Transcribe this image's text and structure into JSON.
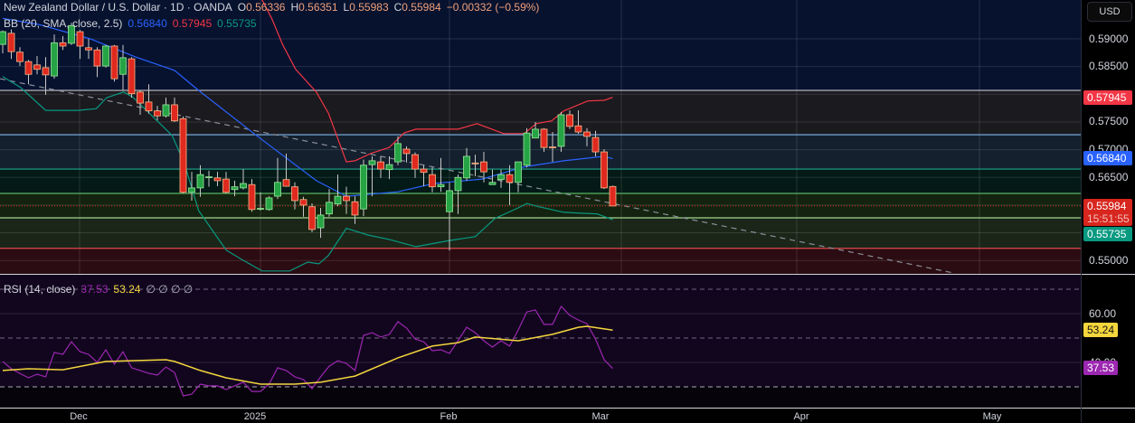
{
  "header": {
    "symbol_title": "New Zealand Dollar / U.S. Dollar · 1D · OANDA",
    "open_label": "O",
    "open": "0.56336",
    "high_label": "H",
    "high": "0.56351",
    "low_label": "L",
    "low": "0.55983",
    "close_label": "C",
    "close": "0.55984",
    "change": "−0.00332 (−0.59%)"
  },
  "bb_legend": {
    "label": "BB (20, SMA, close, 2.5)",
    "basis": "0.56840",
    "upper": "0.57945",
    "lower": "0.55735"
  },
  "rsi_legend": {
    "label": "RSI (14, close)",
    "rsi": "37.53",
    "ma": "53.24",
    "extras": "∅ ∅ ∅ ∅"
  },
  "price_axis": {
    "currency": "USD",
    "ticks": [
      "0.59000",
      "0.58500",
      "0.57500",
      "0.57000",
      "0.56500",
      "0.55000"
    ],
    "badges": {
      "upper": "0.57945",
      "basis": "0.56840",
      "last": "0.55984",
      "countdown": "15:51:55",
      "lower": "0.55735"
    }
  },
  "rsi_axis": {
    "ticks": [
      "60.00",
      "40.00"
    ],
    "badges": {
      "ma": "53.24",
      "rsi": "37.53"
    }
  },
  "time_axis": {
    "labels": [
      "Dec",
      "2025",
      "Feb",
      "Mar",
      "Apr",
      "May"
    ]
  },
  "colors": {
    "up": "#26a445",
    "down": "#e0291f",
    "bb_basis": "#2962ff",
    "bb_upper": "#f23645",
    "bb_lower": "#089981",
    "rsi": "#9c27b0",
    "rsi_ma": "#f5d63d"
  },
  "chart_data": {
    "type": "candlestick",
    "price_range": [
      0.548,
      0.593
    ],
    "candles": [
      [
        0.589,
        0.5915,
        0.5874,
        0.5913
      ],
      [
        0.591,
        0.5917,
        0.5864,
        0.5877
      ],
      [
        0.5876,
        0.5885,
        0.5851,
        0.5859
      ],
      [
        0.5859,
        0.5862,
        0.5818,
        0.5836
      ],
      [
        0.5853,
        0.5869,
        0.5836,
        0.5845
      ],
      [
        0.5848,
        0.5867,
        0.5799,
        0.5835
      ],
      [
        0.5833,
        0.5908,
        0.5828,
        0.5893
      ],
      [
        0.5893,
        0.5905,
        0.588,
        0.5887
      ],
      [
        0.5892,
        0.5929,
        0.5889,
        0.5924
      ],
      [
        0.5913,
        0.5916,
        0.5864,
        0.5887
      ],
      [
        0.5884,
        0.59,
        0.5864,
        0.588
      ],
      [
        0.588,
        0.5885,
        0.5831,
        0.5851
      ],
      [
        0.5851,
        0.5889,
        0.5848,
        0.5887
      ],
      [
        0.5887,
        0.5889,
        0.5823,
        0.5828
      ],
      [
        0.5836,
        0.5889,
        0.5807,
        0.5866
      ],
      [
        0.5864,
        0.5867,
        0.5794,
        0.5801
      ],
      [
        0.5804,
        0.5807,
        0.5763,
        0.5784
      ],
      [
        0.5786,
        0.5818,
        0.5765,
        0.577
      ],
      [
        0.577,
        0.5779,
        0.5753,
        0.5761
      ],
      [
        0.5761,
        0.5794,
        0.5758,
        0.5781
      ],
      [
        0.5781,
        0.5794,
        0.575,
        0.5752
      ],
      [
        0.5756,
        0.576,
        0.5621,
        0.5623
      ],
      [
        0.5623,
        0.566,
        0.5608,
        0.5631
      ],
      [
        0.5631,
        0.5672,
        0.5615,
        0.5655
      ],
      [
        0.565,
        0.5662,
        0.5633,
        0.5651
      ],
      [
        0.5649,
        0.566,
        0.5634,
        0.5644
      ],
      [
        0.5647,
        0.566,
        0.5621,
        0.5623
      ],
      [
        0.5628,
        0.5644,
        0.5616,
        0.5633
      ],
      [
        0.5631,
        0.5665,
        0.5628,
        0.5639
      ],
      [
        0.5637,
        0.5647,
        0.5588,
        0.5592
      ],
      [
        0.5593,
        0.5623,
        0.559,
        0.5594
      ],
      [
        0.5592,
        0.5616,
        0.559,
        0.5613
      ],
      [
        0.5616,
        0.5685,
        0.5611,
        0.5641
      ],
      [
        0.5646,
        0.5693,
        0.5633,
        0.5634
      ],
      [
        0.5633,
        0.5641,
        0.5592,
        0.5608
      ],
      [
        0.561,
        0.5615,
        0.5579,
        0.56
      ],
      [
        0.5597,
        0.5603,
        0.5551,
        0.5556
      ],
      [
        0.5559,
        0.5595,
        0.5541,
        0.5582
      ],
      [
        0.5584,
        0.5629,
        0.5579,
        0.5605
      ],
      [
        0.5602,
        0.5655,
        0.5598,
        0.5616
      ],
      [
        0.5616,
        0.5633,
        0.5584,
        0.5608
      ],
      [
        0.5606,
        0.5616,
        0.5566,
        0.5582
      ],
      [
        0.5593,
        0.5682,
        0.558,
        0.5672
      ],
      [
        0.5673,
        0.5688,
        0.5616,
        0.568
      ],
      [
        0.5678,
        0.5688,
        0.5649,
        0.5665
      ],
      [
        0.5664,
        0.5688,
        0.5647,
        0.5673
      ],
      [
        0.5678,
        0.5724,
        0.5672,
        0.5711
      ],
      [
        0.5701,
        0.5706,
        0.5677,
        0.5693
      ],
      [
        0.5691,
        0.5695,
        0.5649,
        0.5665
      ],
      [
        0.5665,
        0.5672,
        0.5634,
        0.5659
      ],
      [
        0.5655,
        0.5668,
        0.5623,
        0.5633
      ],
      [
        0.5633,
        0.5685,
        0.5624,
        0.5637
      ],
      [
        0.5588,
        0.5641,
        0.5518,
        0.5626
      ],
      [
        0.5626,
        0.5655,
        0.5584,
        0.565
      ],
      [
        0.5649,
        0.5703,
        0.5644,
        0.5688
      ],
      [
        0.5676,
        0.5691,
        0.5652,
        0.5675
      ],
      [
        0.5678,
        0.5696,
        0.5641,
        0.566
      ],
      [
        0.5637,
        0.5664,
        0.5637,
        0.5641
      ],
      [
        0.5646,
        0.5664,
        0.5631,
        0.5655
      ],
      [
        0.5655,
        0.5672,
        0.56,
        0.5641
      ],
      [
        0.5641,
        0.5678,
        0.5623,
        0.5678
      ],
      [
        0.5672,
        0.5739,
        0.5668,
        0.573
      ],
      [
        0.5721,
        0.575,
        0.5721,
        0.5737
      ],
      [
        0.5737,
        0.5739,
        0.5696,
        0.5704
      ],
      [
        0.5705,
        0.5732,
        0.5678,
        0.5704
      ],
      [
        0.5706,
        0.5768,
        0.5696,
        0.5763
      ],
      [
        0.5763,
        0.5771,
        0.5737,
        0.5742
      ],
      [
        0.5743,
        0.5771,
        0.5729,
        0.5732
      ],
      [
        0.5732,
        0.5739,
        0.5706,
        0.5724
      ],
      [
        0.5722,
        0.5734,
        0.5688,
        0.5696
      ],
      [
        0.5696,
        0.5701,
        0.5629,
        0.5631
      ],
      [
        0.56336,
        0.56351,
        0.55983,
        0.55984
      ]
    ],
    "bb_basis": [
      [
        0,
        0.5937
      ],
      [
        4.2,
        0.5926
      ],
      [
        10.2,
        0.59
      ],
      [
        15.5,
        0.5867
      ],
      [
        20,
        0.5843
      ],
      [
        22.8,
        0.5807
      ],
      [
        29.5,
        0.5726
      ],
      [
        36.5,
        0.5644
      ],
      [
        40,
        0.5616
      ],
      [
        46,
        0.5624
      ],
      [
        50.2,
        0.5639
      ],
      [
        55.8,
        0.5647
      ],
      [
        60.7,
        0.5669
      ],
      [
        65.3,
        0.568
      ],
      [
        69.9,
        0.5688
      ],
      [
        71,
        0.5684
      ]
    ],
    "bb_upper": [
      [
        0,
        0.606
      ],
      [
        15,
        0.606
      ],
      [
        25,
        0.602
      ],
      [
        30.2,
        0.597
      ],
      [
        31.3,
        0.5937
      ],
      [
        32.6,
        0.5889
      ],
      [
        34.1,
        0.5845
      ],
      [
        36.5,
        0.5804
      ],
      [
        37.9,
        0.5766
      ],
      [
        40,
        0.5678
      ],
      [
        41,
        0.568
      ],
      [
        42.8,
        0.5693
      ],
      [
        45,
        0.5704
      ],
      [
        46.7,
        0.573
      ],
      [
        48.1,
        0.5737
      ],
      [
        53,
        0.5737
      ],
      [
        55.2,
        0.5747
      ],
      [
        58.3,
        0.5729
      ],
      [
        60.7,
        0.5729
      ],
      [
        62.1,
        0.5747
      ],
      [
        63.9,
        0.5752
      ],
      [
        65.3,
        0.577
      ],
      [
        68.1,
        0.5788
      ],
      [
        70,
        0.5789
      ],
      [
        71,
        0.57945
      ]
    ],
    "bb_lower": [
      [
        0,
        0.5832
      ],
      [
        2.1,
        0.5812
      ],
      [
        5,
        0.5771
      ],
      [
        8.8,
        0.5771
      ],
      [
        10.9,
        0.5774
      ],
      [
        12.1,
        0.5794
      ],
      [
        14.1,
        0.5804
      ],
      [
        15.2,
        0.5794
      ],
      [
        19.7,
        0.5726
      ],
      [
        21.1,
        0.5677
      ],
      [
        22.8,
        0.559
      ],
      [
        26,
        0.5519
      ],
      [
        27.8,
        0.5502
      ],
      [
        30.2,
        0.5481
      ],
      [
        33.4,
        0.5481
      ],
      [
        35.5,
        0.5497
      ],
      [
        36.8,
        0.5494
      ],
      [
        37.9,
        0.5509
      ],
      [
        40,
        0.5558
      ],
      [
        42.5,
        0.5546
      ],
      [
        45,
        0.5538
      ],
      [
        48.1,
        0.5525
      ],
      [
        52,
        0.5536
      ],
      [
        55,
        0.5543
      ],
      [
        57.3,
        0.5576
      ],
      [
        60,
        0.5595
      ],
      [
        61,
        0.5603
      ],
      [
        62.1,
        0.5598
      ],
      [
        65.3,
        0.5587
      ],
      [
        69.2,
        0.5584
      ],
      [
        71,
        0.55735
      ]
    ],
    "levels": [
      {
        "price": 0.5807,
        "color": "#b2b5be",
        "fill": "#1b1a1f"
      },
      {
        "price": 0.5727,
        "color": "#7fb8f0",
        "fill": "#14202d"
      },
      {
        "price": 0.5665,
        "color": "#22a58a",
        "fill": "#031a17"
      },
      {
        "price": 0.5621,
        "color": "#57b460",
        "fill": "#14230f"
      },
      {
        "price": 0.5577,
        "color": "#9fd68f",
        "fill": "#1b2619"
      },
      {
        "price": 0.5522,
        "color": "#e04a4a",
        "fill": "#2b0c12"
      }
    ],
    "trendline": [
      [
        -0.3,
        0.5828
      ],
      [
        110.5,
        0.5478
      ]
    ],
    "last_price": 0.55984,
    "rsi": {
      "range": [
        30,
        70
      ],
      "values": [
        40.4,
        37.4,
        35.5,
        33.7,
        35.2,
        34.1,
        44.1,
        43.3,
        48.5,
        44.4,
        43.3,
        40,
        45.2,
        39.3,
        44.4,
        37.8,
        36.7,
        35.5,
        34.8,
        38.1,
        35.9,
        26.3,
        27,
        31.1,
        30.4,
        30.4,
        28.9,
        30.4,
        31.9,
        28.1,
        28.1,
        31.1,
        37.8,
        36.7,
        34.1,
        33,
        29.3,
        34.1,
        38.5,
        40.7,
        39.6,
        36.7,
        51.1,
        52.2,
        50.4,
        51.5,
        56.7,
        54.1,
        49.6,
        48.5,
        44.8,
        45.2,
        43.7,
        48.9,
        54.4,
        52.2,
        48.9,
        46.3,
        48.9,
        46.7,
        53.3,
        60.7,
        61.5,
        55.6,
        55.6,
        63,
        59.3,
        57.4,
        55.9,
        49.6,
        41.1,
        37.53
      ],
      "ma": [
        [
          0,
          36.7
        ],
        [
          3,
          37.4
        ],
        [
          7,
          37
        ],
        [
          12,
          40.4
        ],
        [
          19,
          41.1
        ],
        [
          20,
          40.4
        ],
        [
          23,
          36.7
        ],
        [
          26,
          33.7
        ],
        [
          30,
          31.1
        ],
        [
          34,
          31.1
        ],
        [
          37,
          31.9
        ],
        [
          41,
          34.4
        ],
        [
          46,
          41.9
        ],
        [
          50,
          46.7
        ],
        [
          53,
          48.1
        ],
        [
          55,
          50.4
        ],
        [
          60,
          48.9
        ],
        [
          64,
          51.5
        ],
        [
          67,
          54.4
        ],
        [
          68,
          54.8
        ],
        [
          71,
          53.24
        ]
      ]
    }
  }
}
